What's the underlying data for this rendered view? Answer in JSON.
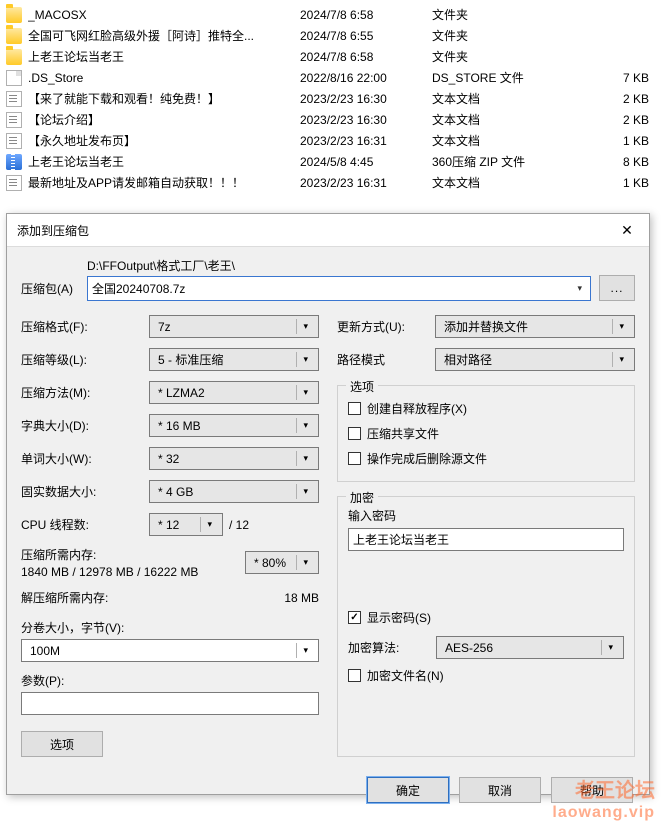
{
  "files": [
    {
      "icon": "folder",
      "name": "_MACOSX",
      "date": "2024/7/8 6:58",
      "type": "文件夹",
      "size": ""
    },
    {
      "icon": "folder",
      "name": "全国可飞网红脸高级外援［阿诗］推特全...",
      "date": "2024/7/8 6:55",
      "type": "文件夹",
      "size": ""
    },
    {
      "icon": "folder",
      "name": "上老王论坛当老王",
      "date": "2024/7/8 6:58",
      "type": "文件夹",
      "size": ""
    },
    {
      "icon": "doc",
      "name": ".DS_Store",
      "date": "2022/8/16 22:00",
      "type": "DS_STORE 文件",
      "size": "7 KB"
    },
    {
      "icon": "txt",
      "name": "【来了就能下载和观看！纯免费！】",
      "date": "2023/2/23 16:30",
      "type": "文本文档",
      "size": "2 KB"
    },
    {
      "icon": "txt",
      "name": "【论坛介绍】",
      "date": "2023/2/23 16:30",
      "type": "文本文档",
      "size": "2 KB"
    },
    {
      "icon": "txt",
      "name": "【永久地址发布页】",
      "date": "2023/2/23 16:31",
      "type": "文本文档",
      "size": "1 KB"
    },
    {
      "icon": "zip",
      "name": "上老王论坛当老王",
      "date": "2024/5/8 4:45",
      "type": "360压缩 ZIP 文件",
      "size": "8 KB"
    },
    {
      "icon": "txt",
      "name": "最新地址及APP请发邮箱自动获取！！！",
      "date": "2023/2/23 16:31",
      "type": "文本文档",
      "size": "1 KB"
    }
  ],
  "dialog": {
    "title": "添加到压缩包",
    "archive_label": "压缩包(A)",
    "archive_path_label": "D:\\FFOutput\\格式工厂\\老王\\",
    "archive_value": "全国20240708.7z",
    "browse": "...",
    "left": {
      "format_label": "压缩格式(F):",
      "format_value": "7z",
      "level_label": "压缩等级(L):",
      "level_value": "5 - 标准压缩",
      "method_label": "压缩方法(M):",
      "method_value": "* LZMA2",
      "dict_label": "字典大小(D):",
      "dict_value": "* 16 MB",
      "word_label": "单词大小(W):",
      "word_value": "* 32",
      "solid_label": "固实数据大小:",
      "solid_value": "* 4 GB",
      "cpu_label": "CPU 线程数:",
      "cpu_value": "* 12",
      "cpu_total": "/ 12",
      "mem_compress_label": "压缩所需内存:",
      "mem_compress_value": "1840 MB / 12978 MB / 16222 MB",
      "mem_percent": "* 80%",
      "mem_decompress_label": "解压缩所需内存:",
      "mem_decompress_value": "18 MB",
      "split_label": "分卷大小，字节(V):",
      "split_value": "100M",
      "params_label": "参数(P):",
      "params_value": "",
      "options_btn": "选项"
    },
    "right": {
      "update_label": "更新方式(U):",
      "update_value": "添加并替换文件",
      "pathmode_label": "路径模式",
      "pathmode_value": "相对路径",
      "options_title": "选项",
      "opt_sfx": "创建自释放程序(X)",
      "opt_shared": "压缩共享文件",
      "opt_delete": "操作完成后删除源文件",
      "enc_title": "加密",
      "enc_pwd_label": "输入密码",
      "enc_pwd_value": "上老王论坛当老王",
      "enc_show": "显示密码(S)",
      "enc_algo_label": "加密算法:",
      "enc_algo_value": "AES-256",
      "enc_names": "加密文件名(N)"
    },
    "buttons": {
      "ok": "确定",
      "cancel": "取消",
      "help": "帮助"
    }
  },
  "watermark": {
    "line1": "老王论坛",
    "line2": "laowang.vip"
  }
}
